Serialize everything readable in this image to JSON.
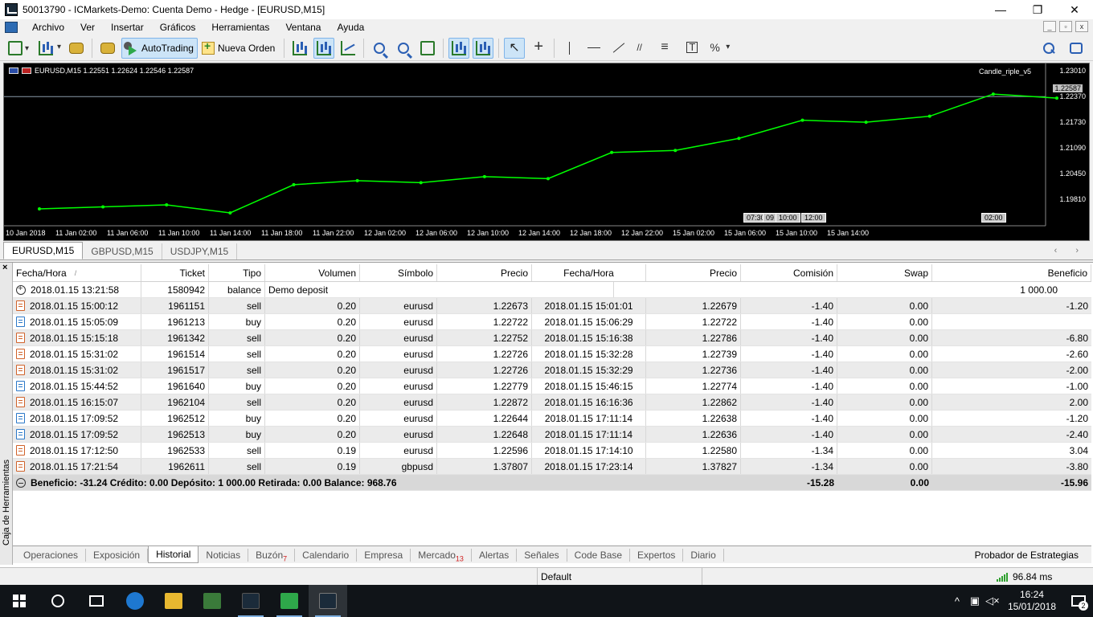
{
  "window": {
    "title": "50013790 - ICMarkets-Demo: Cuenta Demo - Hedge - [EURUSD,M15]",
    "minimize": "—",
    "maximize": "❐",
    "close": "✕"
  },
  "menu": [
    "Archivo",
    "Ver",
    "Insertar",
    "Gráficos",
    "Herramientas",
    "Ventana",
    "Ayuda"
  ],
  "toolbar": {
    "autotrading_label": "AutoTrading",
    "new_order_label": "Nueva Orden"
  },
  "chart": {
    "header": "EURUSD,M15  1.22551 1.22624 1.22546 1.22587",
    "indicator": "Candle_riple_v5",
    "current_price": "1.22587",
    "price_labels": [
      "1.23010",
      "1.22370",
      "1.21730",
      "1.21090",
      "1.20450",
      "1.19810"
    ],
    "time_labels": [
      "10 Jan 2018",
      "11 Jan 02:00",
      "11 Jan 06:00",
      "11 Jan 10:00",
      "11 Jan 14:00",
      "11 Jan 18:00",
      "11 Jan 22:00",
      "12 Jan 02:00",
      "12 Jan 06:00",
      "12 Jan 10:00",
      "12 Jan 14:00",
      "12 Jan 18:00",
      "12 Jan 22:00",
      "15 Jan 02:00",
      "15 Jan 06:00",
      "15 Jan 10:00",
      "15 Jan 14:00"
    ],
    "time_boxes": [
      "07:30",
      "09",
      "10:00",
      "12:00",
      "02:00"
    ],
    "colors": {
      "background": "#000000",
      "candles": "#00ff00"
    }
  },
  "chart_data": {
    "type": "line",
    "title": "EURUSD,M15",
    "xlabel": "",
    "ylabel": "",
    "ylim": [
      1.195,
      1.2325
    ],
    "x": [
      "10 Jan 2018",
      "11 Jan 02:00",
      "11 Jan 06:00",
      "11 Jan 10:00",
      "11 Jan 14:00",
      "11 Jan 18:00",
      "11 Jan 22:00",
      "12 Jan 02:00",
      "12 Jan 06:00",
      "12 Jan 10:00",
      "12 Jan 14:00",
      "12 Jan 18:00",
      "12 Jan 22:00",
      "15 Jan 02:00",
      "15 Jan 06:00",
      "15 Jan 10:00",
      "15 Jan 14:00"
    ],
    "series": [
      {
        "values": [
          1.198,
          1.1985,
          1.199,
          1.197,
          1.204,
          1.205,
          1.2045,
          1.206,
          1.2055,
          1.212,
          1.2125,
          1.2155,
          1.22,
          1.2195,
          1.221,
          1.2265,
          1.2255
        ]
      }
    ],
    "grid": false
  },
  "chart_tabs": [
    "EURUSD,M15",
    "GBPUSD,M15",
    "USDJPY,M15"
  ],
  "table": {
    "columns": [
      "Fecha/Hora",
      "Ticket",
      "Tipo",
      "Volumen",
      "Símbolo",
      "Precio",
      "Fecha/Hora",
      "Precio",
      "Comisión",
      "Swap",
      "Beneficio"
    ],
    "deposit_row": [
      "2018.01.15 13:21:58",
      "1580942",
      "balance",
      "Demo deposit",
      "",
      "",
      "",
      "",
      "",
      "",
      "1 000.00"
    ],
    "rows": [
      [
        "2018.01.15 15:00:12",
        "1961151",
        "sell",
        "0.20",
        "eurusd",
        "1.22673",
        "2018.01.15 15:01:01",
        "1.22679",
        "-1.40",
        "0.00",
        "-1.20"
      ],
      [
        "2018.01.15 15:05:09",
        "1961213",
        "buy",
        "0.20",
        "eurusd",
        "1.22722",
        "2018.01.15 15:06:29",
        "1.22722",
        "-1.40",
        "0.00",
        ""
      ],
      [
        "2018.01.15 15:15:18",
        "1961342",
        "sell",
        "0.20",
        "eurusd",
        "1.22752",
        "2018.01.15 15:16:38",
        "1.22786",
        "-1.40",
        "0.00",
        "-6.80"
      ],
      [
        "2018.01.15 15:31:02",
        "1961514",
        "sell",
        "0.20",
        "eurusd",
        "1.22726",
        "2018.01.15 15:32:28",
        "1.22739",
        "-1.40",
        "0.00",
        "-2.60"
      ],
      [
        "2018.01.15 15:31:02",
        "1961517",
        "sell",
        "0.20",
        "eurusd",
        "1.22726",
        "2018.01.15 15:32:29",
        "1.22736",
        "-1.40",
        "0.00",
        "-2.00"
      ],
      [
        "2018.01.15 15:44:52",
        "1961640",
        "buy",
        "0.20",
        "eurusd",
        "1.22779",
        "2018.01.15 15:46:15",
        "1.22774",
        "-1.40",
        "0.00",
        "-1.00"
      ],
      [
        "2018.01.15 16:15:07",
        "1962104",
        "sell",
        "0.20",
        "eurusd",
        "1.22872",
        "2018.01.15 16:16:36",
        "1.22862",
        "-1.40",
        "0.00",
        "2.00"
      ],
      [
        "2018.01.15 17:09:52",
        "1962512",
        "buy",
        "0.20",
        "eurusd",
        "1.22644",
        "2018.01.15 17:11:14",
        "1.22638",
        "-1.40",
        "0.00",
        "-1.20"
      ],
      [
        "2018.01.15 17:09:52",
        "1962513",
        "buy",
        "0.20",
        "eurusd",
        "1.22648",
        "2018.01.15 17:11:14",
        "1.22636",
        "-1.40",
        "0.00",
        "-2.40"
      ],
      [
        "2018.01.15 17:12:50",
        "1962533",
        "sell",
        "0.19",
        "eurusd",
        "1.22596",
        "2018.01.15 17:14:10",
        "1.22580",
        "-1.34",
        "0.00",
        "3.04"
      ],
      [
        "2018.01.15 17:21:54",
        "1962611",
        "sell",
        "0.19",
        "gbpusd",
        "1.37807",
        "2018.01.15 17:23:14",
        "1.37827",
        "-1.34",
        "0.00",
        "-3.80"
      ]
    ],
    "summary": {
      "text": "Beneficio: -31.24  Crédito: 0.00  Depósito: 1 000.00  Retirada: 0.00  Balance: 968.76",
      "commission": "-15.28",
      "swap": "0.00",
      "profit": "-15.96"
    }
  },
  "toolbox": {
    "vertical_label": "Caja de Herramientas",
    "close": "×"
  },
  "bottom_tabs": [
    {
      "label": "Operaciones",
      "badge": ""
    },
    {
      "label": "Exposición",
      "badge": ""
    },
    {
      "label": "Historial",
      "badge": ""
    },
    {
      "label": "Noticias",
      "badge": ""
    },
    {
      "label": "Buzón",
      "badge": "7"
    },
    {
      "label": "Calendario",
      "badge": ""
    },
    {
      "label": "Empresa",
      "badge": ""
    },
    {
      "label": "Mercado",
      "badge": "13"
    },
    {
      "label": "Alertas",
      "badge": ""
    },
    {
      "label": "Señales",
      "badge": ""
    },
    {
      "label": "Code Base",
      "badge": ""
    },
    {
      "label": "Expertos",
      "badge": ""
    },
    {
      "label": "Diario",
      "badge": ""
    }
  ],
  "strategy_tester": "Probador de Estrategias",
  "status": {
    "profile": "Default",
    "ping": "96.84 ms"
  },
  "taskbar": {
    "time": "16:24",
    "date": "15/01/2018",
    "notifications": "2"
  }
}
